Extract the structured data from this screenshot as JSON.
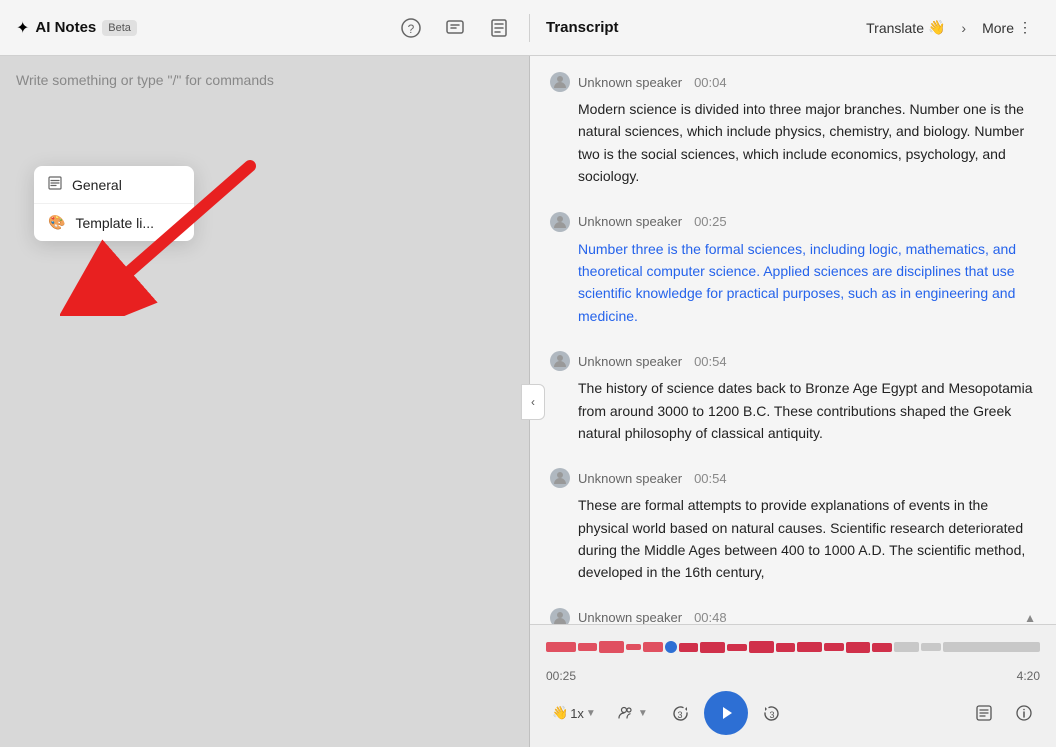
{
  "header": {
    "logo_icon": "✦",
    "app_name": "AI Notes",
    "beta_label": "Beta",
    "icon_help": "?",
    "icon_chat": "💬",
    "icon_note": "📋",
    "transcript_title": "Transcript",
    "translate_label": "Translate",
    "translate_icon": "👋",
    "more_label": "More",
    "more_icon": "⋮"
  },
  "editor": {
    "placeholder": "Write something or type \"/\" for commands"
  },
  "dropdown": {
    "items": [
      {
        "icon": "📄",
        "label": "General"
      },
      {
        "icon": "🎨",
        "label": "Template li..."
      }
    ]
  },
  "transcript": {
    "blocks": [
      {
        "speaker": "Unknown speaker",
        "time": "00:04",
        "text": "Modern science is divided into three major branches. Number one is the natural sciences, which include physics, chemistry, and biology. Number two is the social sciences, which include economics, psychology, and sociology.",
        "highlighted": false
      },
      {
        "speaker": "Unknown speaker",
        "time": "00:25",
        "text": "Number three is the formal sciences, including logic, mathematics, and theoretical computer science. Applied sciences are disciplines that use scientific knowledge for practical purposes, such as in engineering and medicine.",
        "highlighted": true
      },
      {
        "speaker": "Unknown speaker",
        "time": "00:54",
        "text": "The history of science dates back to Bronze Age Egypt and Mesopotamia from around 3000 to 1200 B.C. These contributions shaped the Greek natural philosophy of classical antiquity.",
        "highlighted": false
      },
      {
        "speaker": "Unknown speaker",
        "time": "00:54",
        "text": "These are formal attempts to provide explanations of events in the physical world based on natural causes. Scientific research deteriorated during the Middle Ages between 400 to 1000 A.D. The scientific method, developed in the 16th century,",
        "highlighted": false
      }
    ],
    "partial_speaker": "Unknown speaker",
    "partial_time": "00:48"
  },
  "player": {
    "current_time": "00:25",
    "total_time": "4:20",
    "speed_label": "1x",
    "skip_back_seconds": "3",
    "skip_fwd_seconds": "3",
    "progress_percent": 23,
    "collapse_icon": "▲"
  }
}
